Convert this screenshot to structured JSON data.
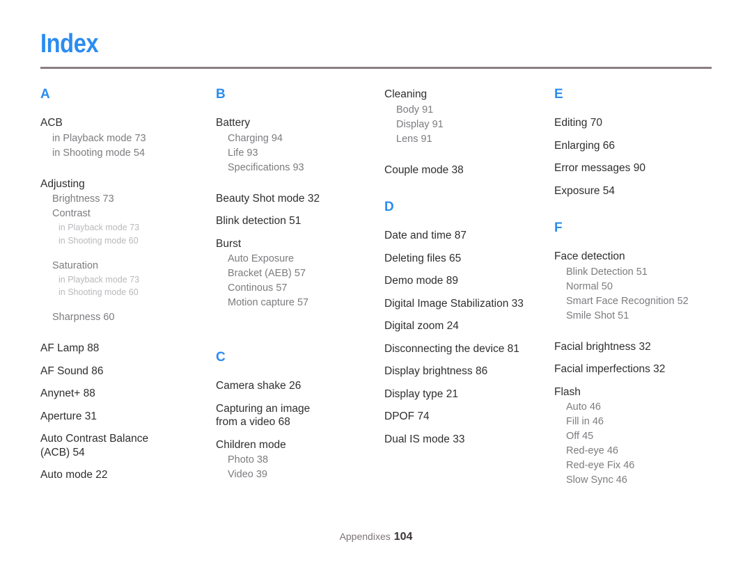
{
  "document": {
    "title": "Index",
    "accent_color": "#2b8cf0",
    "rule_color": "#897f82"
  },
  "footer": {
    "label": "Appendixes",
    "page_number": "104"
  },
  "columns": [
    {
      "letter": "A",
      "entries": [
        {
          "text": "ACB",
          "level": 1,
          "children": [
            {
              "text": "in Playback mode  73",
              "level": 2
            },
            {
              "text": "in Shooting mode  54",
              "level": 2
            }
          ]
        },
        {
          "text": "Adjusting",
          "level": 1,
          "children": [
            {
              "text": "Brightness  73",
              "level": 2
            },
            {
              "text": "Contrast",
              "level": 2,
              "children": [
                {
                  "text": "in Playback mode  73",
                  "level": 3
                },
                {
                  "text": "in Shooting mode  60",
                  "level": 3
                }
              ]
            },
            {
              "text": "Saturation",
              "level": 2,
              "children": [
                {
                  "text": "in Playback mode  73",
                  "level": 3
                },
                {
                  "text": "in Shooting mode  60",
                  "level": 3
                }
              ]
            },
            {
              "text": "Sharpness  60",
              "level": 2
            }
          ]
        },
        {
          "text": "AF Lamp  88",
          "level": 1
        },
        {
          "text": "AF Sound  86",
          "level": 1
        },
        {
          "text": "Anynet+  88",
          "level": 1
        },
        {
          "text": "Aperture  31",
          "level": 1
        },
        {
          "text": "Auto Contrast Balance\n(ACB)  54",
          "level": 1
        },
        {
          "text": "Auto mode  22",
          "level": 1
        }
      ]
    },
    {
      "letter": "B",
      "entries": [
        {
          "text": "Battery",
          "level": 1,
          "children": [
            {
              "text": "Charging  94",
              "level": 2
            },
            {
              "text": "Life  93",
              "level": 2
            },
            {
              "text": "Specifications  93",
              "level": 2
            }
          ]
        },
        {
          "text": "Beauty Shot mode  32",
          "level": 1
        },
        {
          "text": "Blink detection  51",
          "level": 1
        },
        {
          "text": "Burst",
          "level": 1,
          "children": [
            {
              "text": "Auto Exposure\nBracket (AEB)  57",
              "level": 2
            },
            {
              "text": "Continous  57",
              "level": 2
            },
            {
              "text": "Motion capture  57",
              "level": 2
            }
          ]
        }
      ],
      "second_letter": "C",
      "second_entries": [
        {
          "text": "Camera shake  26",
          "level": 1
        },
        {
          "text": "Capturing an image\nfrom a video  68",
          "level": 1
        },
        {
          "text": "Children mode",
          "level": 1,
          "children": [
            {
              "text": "Photo  38",
              "level": 2
            },
            {
              "text": "Video  39",
              "level": 2
            }
          ]
        }
      ]
    },
    {
      "letter": "",
      "entries": [
        {
          "text": "Cleaning",
          "level": 1,
          "children": [
            {
              "text": "Body  91",
              "level": 2
            },
            {
              "text": "Display  91",
              "level": 2
            },
            {
              "text": "Lens  91",
              "level": 2
            }
          ]
        },
        {
          "text": "Couple mode  38",
          "level": 1
        }
      ],
      "second_letter": "D",
      "second_entries": [
        {
          "text": "Date and time  87",
          "level": 1
        },
        {
          "text": "Deleting files  65",
          "level": 1
        },
        {
          "text": "Demo mode  89",
          "level": 1
        },
        {
          "text": "Digital Image Stabilization  33",
          "level": 1
        },
        {
          "text": "Digital zoom  24",
          "level": 1
        },
        {
          "text": "Disconnecting the device  81",
          "level": 1
        },
        {
          "text": "Display brightness  86",
          "level": 1
        },
        {
          "text": "Display type  21",
          "level": 1
        },
        {
          "text": "DPOF  74",
          "level": 1
        },
        {
          "text": "Dual IS mode  33",
          "level": 1
        }
      ]
    },
    {
      "letter": "E",
      "entries": [
        {
          "text": "Editing  70",
          "level": 1
        },
        {
          "text": "Enlarging  66",
          "level": 1
        },
        {
          "text": "Error messages  90",
          "level": 1
        },
        {
          "text": "Exposure  54",
          "level": 1
        }
      ],
      "second_letter": "F",
      "second_entries": [
        {
          "text": "Face detection",
          "level": 1,
          "children": [
            {
              "text": "Blink Detection  51",
              "level": 2
            },
            {
              "text": "Normal  50",
              "level": 2
            },
            {
              "text": "Smart Face Recognition  52",
              "level": 2
            },
            {
              "text": "Smile Shot  51",
              "level": 2
            }
          ]
        },
        {
          "text": "Facial brightness  32",
          "level": 1
        },
        {
          "text": "Facial imperfections  32",
          "level": 1
        },
        {
          "text": "Flash",
          "level": 1,
          "children": [
            {
              "text": "Auto  46",
              "level": 2
            },
            {
              "text": "Fill in  46",
              "level": 2
            },
            {
              "text": "Off  45",
              "level": 2
            },
            {
              "text": "Red-eye  46",
              "level": 2
            },
            {
              "text": "Red-eye Fix  46",
              "level": 2
            },
            {
              "text": "Slow Sync  46",
              "level": 2
            }
          ]
        }
      ]
    }
  ]
}
